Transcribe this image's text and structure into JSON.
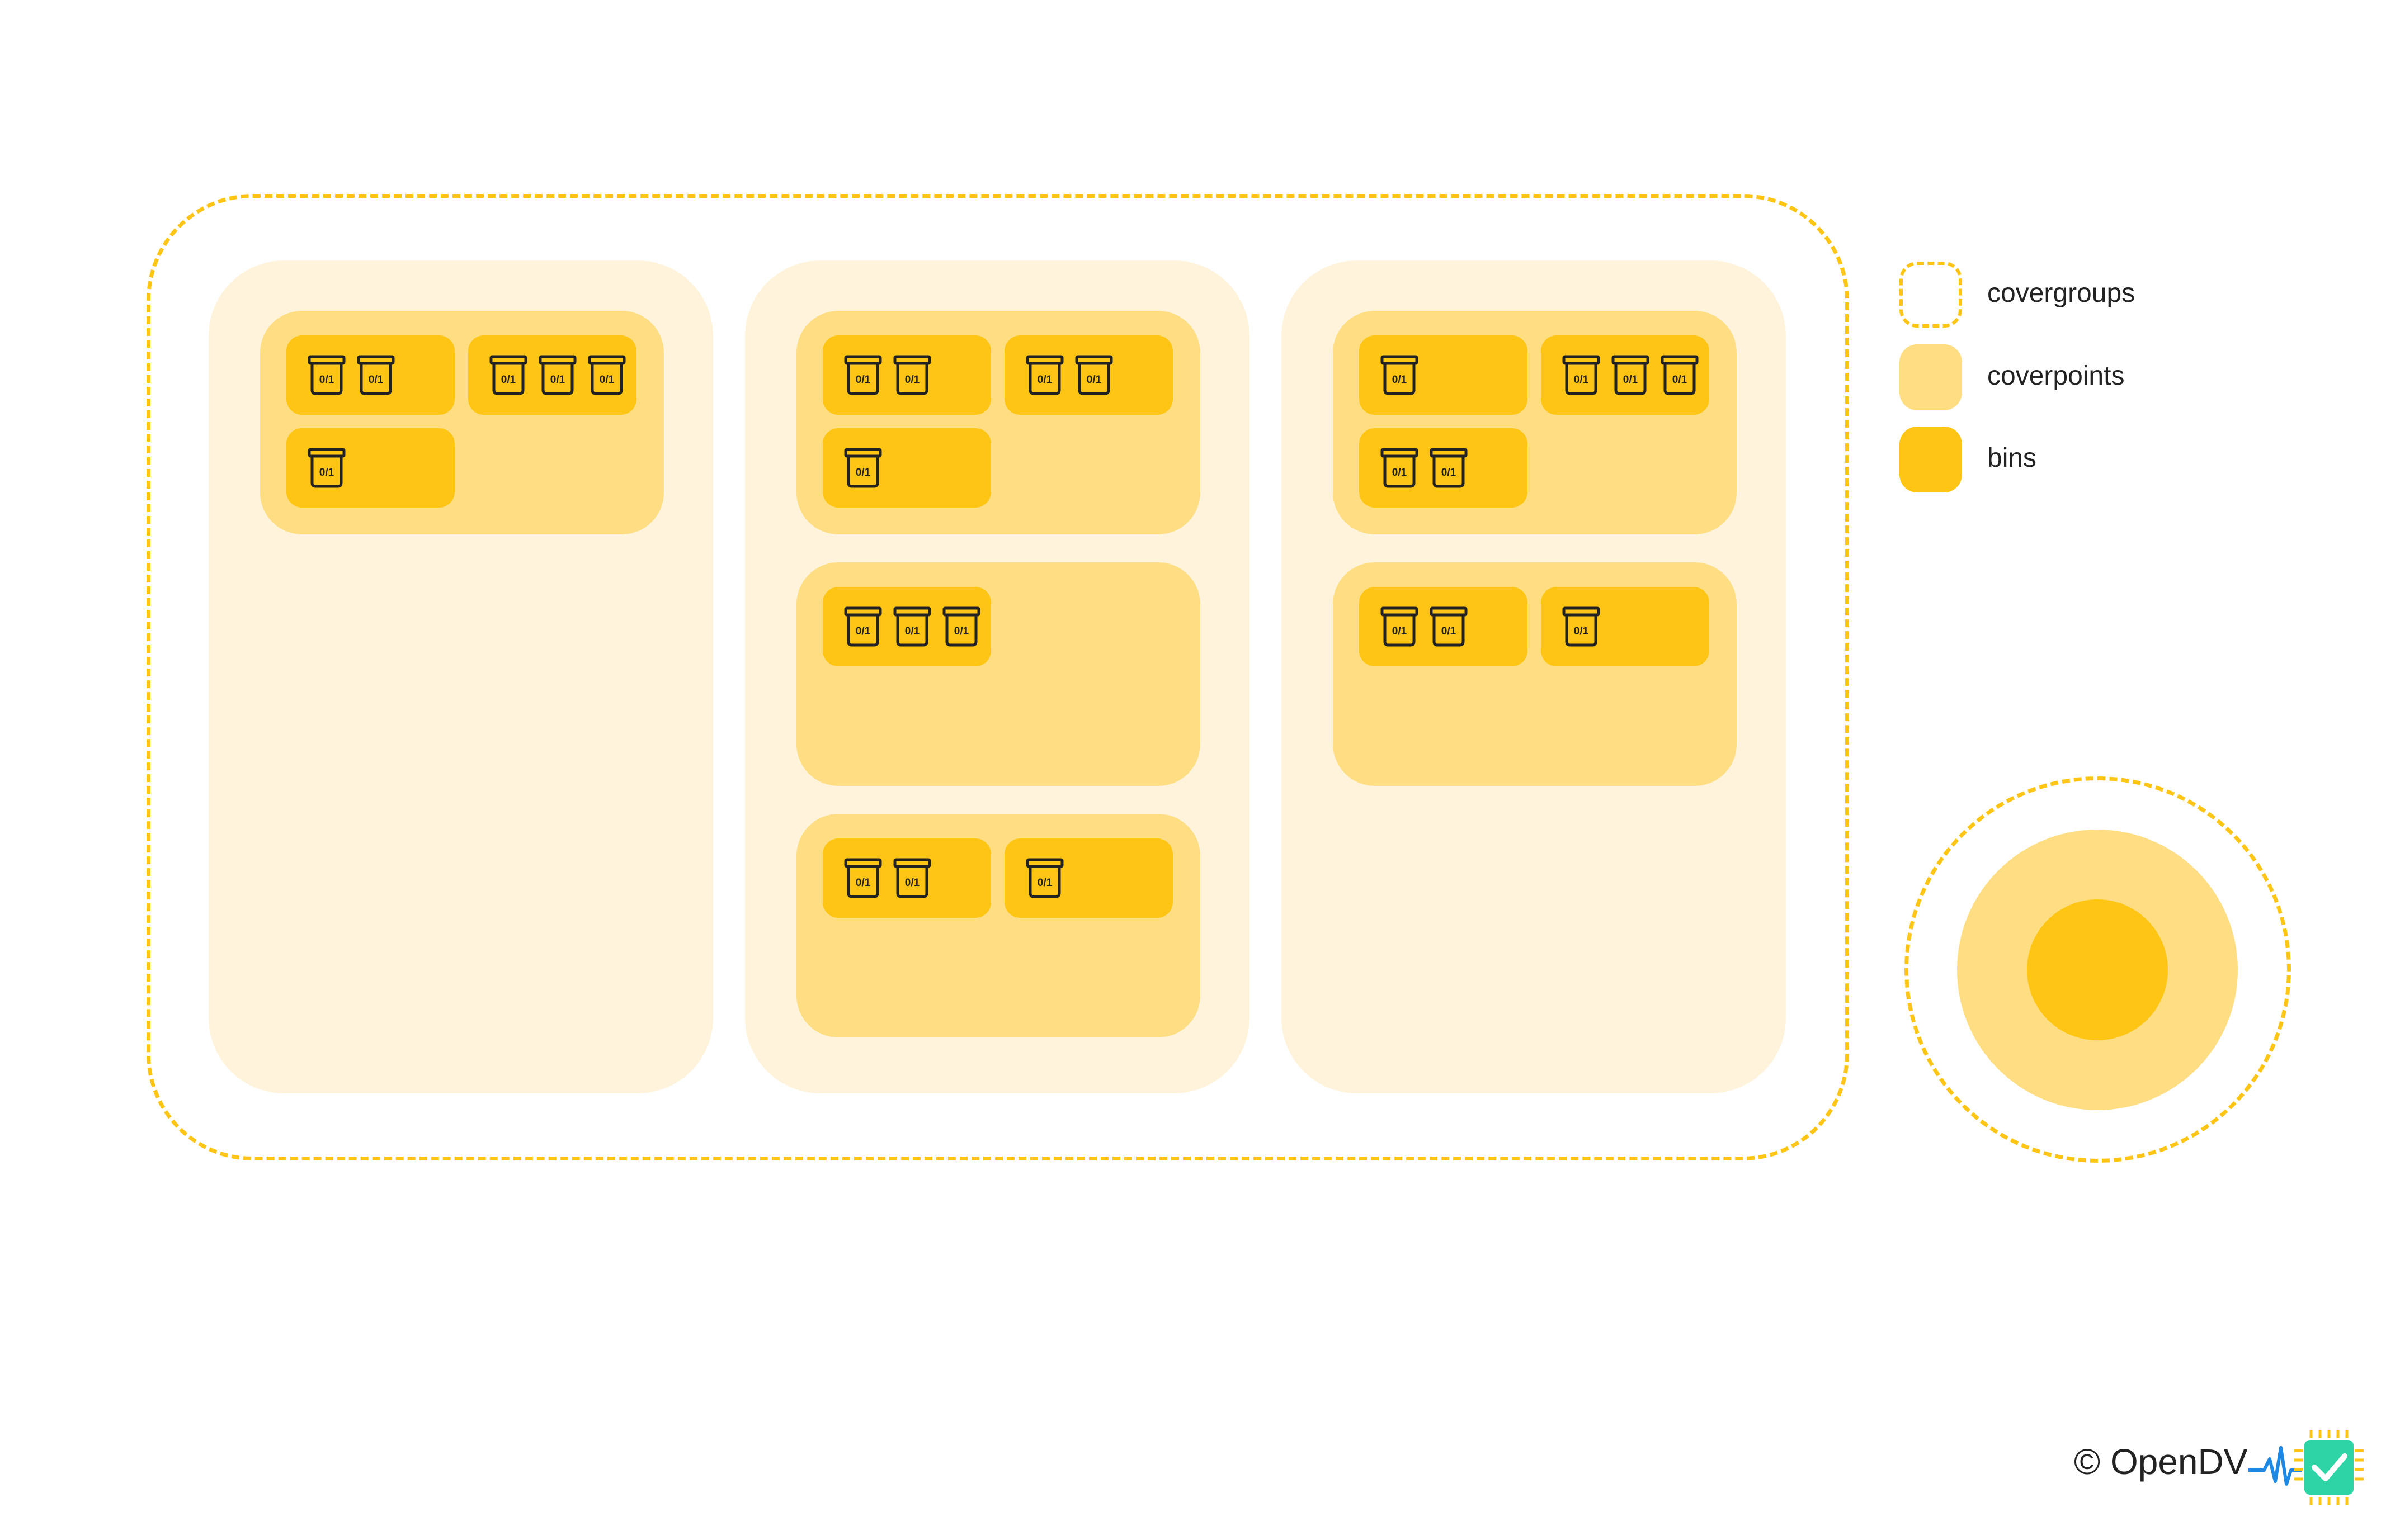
{
  "colors": {
    "covergroup_border": "#FFC515",
    "covergroup_bg": "#FFF4DB",
    "coverpoint_bg": "#FFDD82",
    "bin_bg": "#FFC515",
    "text": "#222222"
  },
  "bin_icon_label": "0/1",
  "legend": {
    "covergroups": "covergroups",
    "coverpoints": "coverpoints",
    "bins": "bins"
  },
  "diagram": {
    "covergroups": [
      {
        "coverpoints": [
          {
            "bins": [
              2,
              3,
              1
            ]
          }
        ]
      },
      {
        "coverpoints": [
          {
            "bins": [
              2,
              2,
              1
            ]
          },
          {
            "bins": [
              3
            ]
          },
          {
            "bins": [
              2,
              1
            ]
          }
        ]
      },
      {
        "coverpoints": [
          {
            "bins": [
              1,
              3,
              2
            ]
          },
          {
            "bins": [
              2,
              1
            ]
          }
        ]
      }
    ]
  },
  "copyright": "© OpenDV",
  "logo": {
    "icon": "check-chip-logo-icon",
    "accent": "#2FD4A6",
    "pulse": "#1E88E5"
  }
}
